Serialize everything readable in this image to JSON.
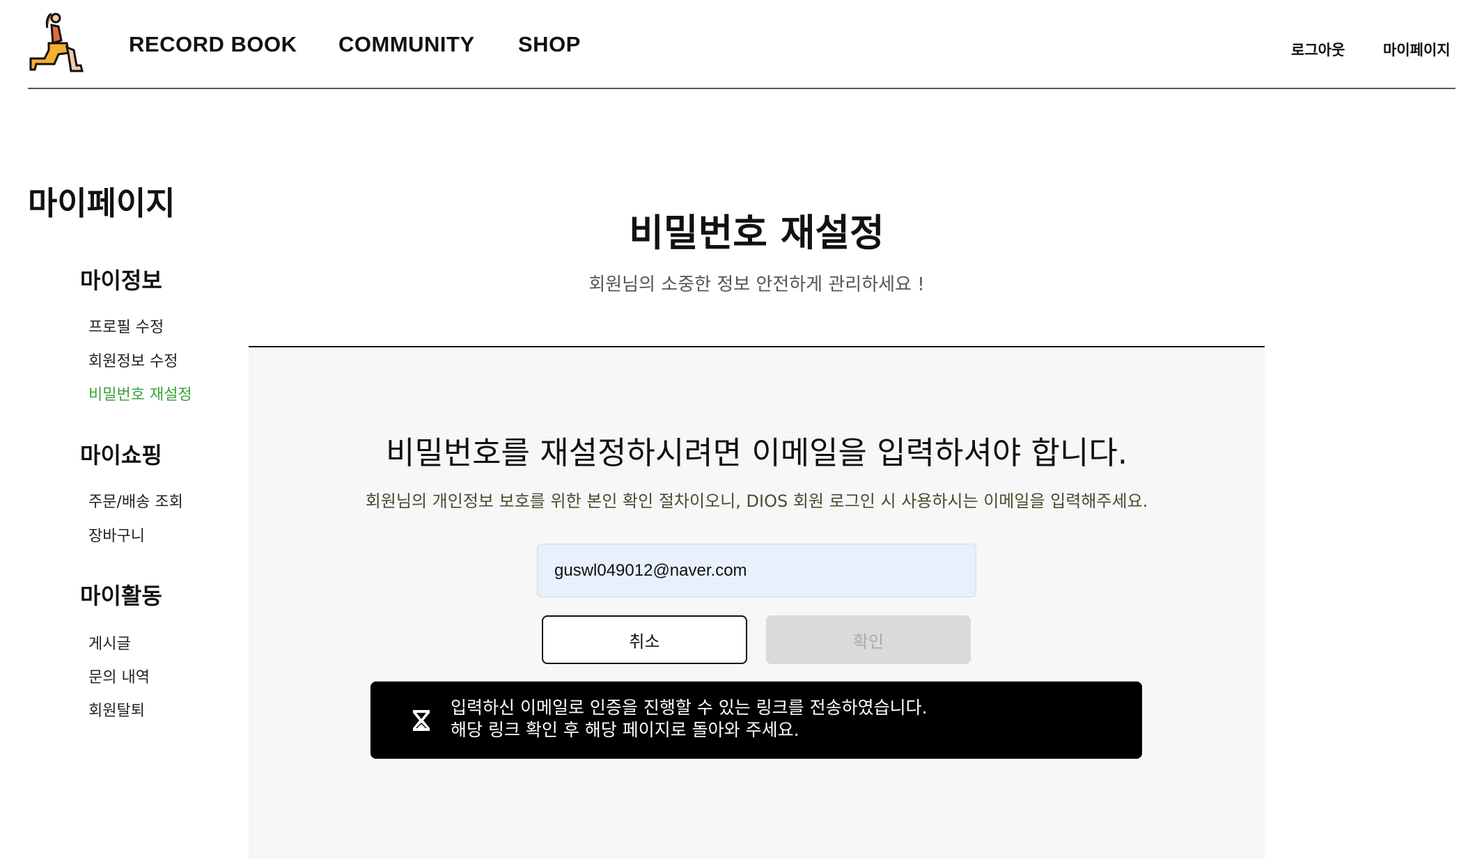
{
  "header": {
    "nav": [
      "RECORD BOOK",
      "COMMUNITY",
      "SHOP"
    ],
    "logout": "로그아웃",
    "mypage": "마이페이지"
  },
  "sidebar": {
    "title": "마이페이지",
    "sections": [
      {
        "label": "마이정보",
        "items": [
          "프로필 수정",
          "회원정보 수정",
          "비밀번호 재설정"
        ]
      },
      {
        "label": "마이쇼핑",
        "items": [
          "주문/배송 조회",
          "장바구니"
        ]
      },
      {
        "label": "마이활동",
        "items": [
          "게시글",
          "문의 내역",
          "회원탈퇴"
        ]
      }
    ],
    "active_color": "#3aa23a"
  },
  "main": {
    "title": "비밀번호 재설정",
    "subtitle": "회원님의 소중한 정보 안전하게 관리하세요 !",
    "heading": "비밀번호를 재설정하시려면 이메일을 입력하셔야 합니다.",
    "description": "회원님의 개인정보 보호를 위한 본인 확인 절차이오니, DIOS 회원 로그인 시 사용하시는 이메일을 입력해주세요.",
    "email_value": "guswl049012@naver.com",
    "cancel": "취소",
    "confirm": "확인",
    "toast": {
      "icon": "hourglass-icon",
      "line1": "입력하신 이메일로 인증을 진행할 수 있는 링크를 전송하였습니다.",
      "line2": "해당 링크 확인 후 해당 페이지로 돌아와 주세요."
    }
  }
}
